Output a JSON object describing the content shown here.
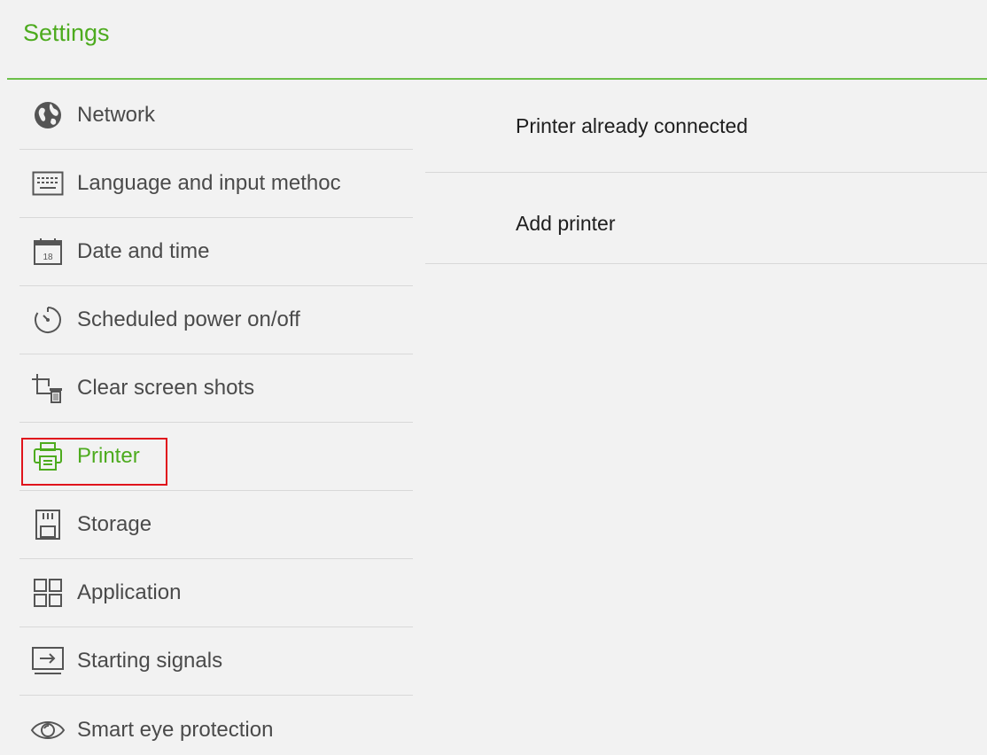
{
  "header": {
    "title": "Settings"
  },
  "sidebar": {
    "items": [
      {
        "label": "Network",
        "icon": "globe-icon"
      },
      {
        "label": "Language and input methoc",
        "icon": "keyboard-icon"
      },
      {
        "label": "Date and time",
        "icon": "calendar-icon"
      },
      {
        "label": "Scheduled power on/off",
        "icon": "timer-icon"
      },
      {
        "label": "Clear screen shots",
        "icon": "crop-trash-icon"
      },
      {
        "label": "Printer",
        "icon": "printer-icon",
        "active": true
      },
      {
        "label": "Storage",
        "icon": "sd-card-icon"
      },
      {
        "label": "Application",
        "icon": "apps-grid-icon"
      },
      {
        "label": "Starting signals",
        "icon": "input-source-icon"
      },
      {
        "label": "Smart eye protection",
        "icon": "eye-icon"
      }
    ]
  },
  "content": {
    "items": [
      {
        "label": "Printer already connected"
      },
      {
        "label": "Add printer"
      }
    ]
  },
  "colors": {
    "accent": "#4dab1e",
    "highlight": "#e0141c",
    "text": "#4a4a4a",
    "divider": "#d8d8d8",
    "background": "#f2f2f2"
  }
}
